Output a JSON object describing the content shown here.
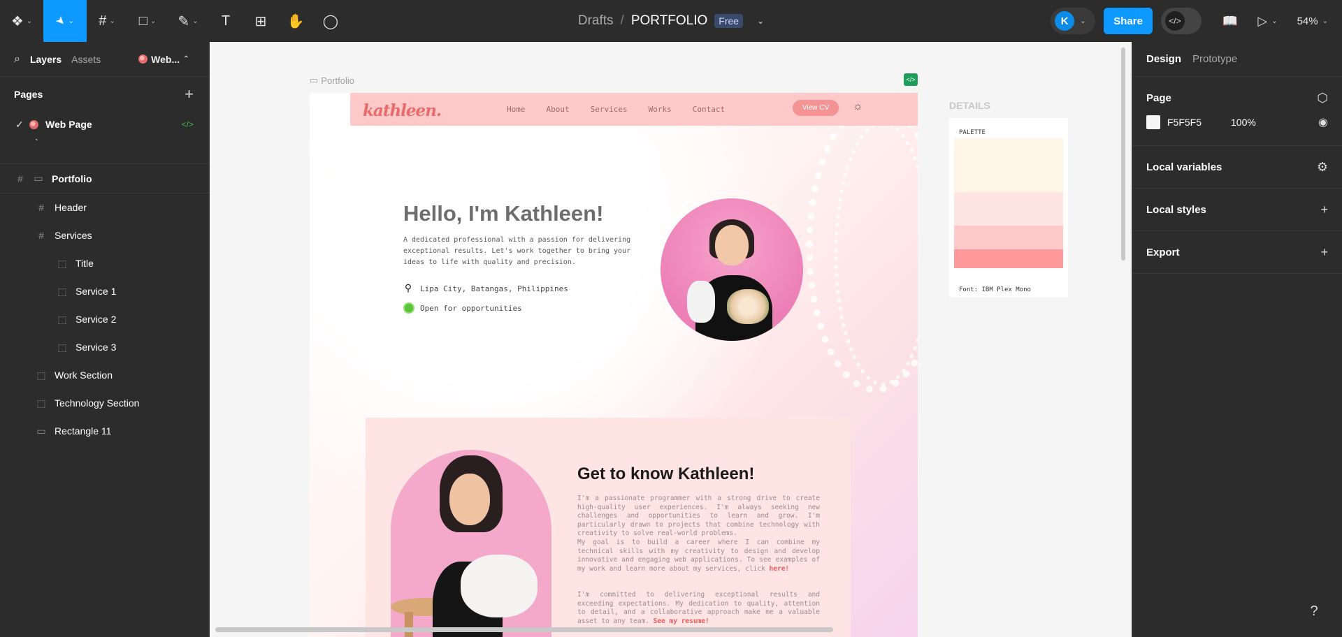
{
  "toolbar": {
    "tools": [
      {
        "icon": "figma-menu-icon",
        "glyph": "❖"
      },
      {
        "icon": "move-cursor-icon",
        "glyph": "➤"
      },
      {
        "icon": "frame-icon",
        "glyph": "#"
      },
      {
        "icon": "rectangle-icon",
        "glyph": "□"
      },
      {
        "icon": "pen-icon",
        "glyph": "✎"
      },
      {
        "icon": "text-icon",
        "glyph": "T"
      },
      {
        "icon": "resources-icon",
        "glyph": "⊞"
      },
      {
        "icon": "hand-icon",
        "glyph": "✋"
      },
      {
        "icon": "comment-icon",
        "glyph": "◯"
      }
    ],
    "breadcrumb_drafts": "Drafts",
    "breadcrumb_sep": "/",
    "file_title": "PORTFOLIO",
    "plan_badge": "Free",
    "avatar_initial": "K",
    "share_label": "Share",
    "zoom": "54%",
    "accent": "#0d99ff"
  },
  "left": {
    "tab_layers": "Layers",
    "tab_assets": "Assets",
    "page_switch": "Web...",
    "pages_label": "Pages",
    "page_name": "Web Page",
    "stray_mark": "`",
    "root_layer": "Portfolio",
    "layers": [
      {
        "name": "Header",
        "icon": "#",
        "indent": 1
      },
      {
        "name": "Services",
        "icon": "#",
        "indent": 1
      },
      {
        "name": "Title",
        "icon": "⬚",
        "indent": 2
      },
      {
        "name": "Service 1",
        "icon": "⬚",
        "indent": 2
      },
      {
        "name": "Service 2",
        "icon": "⬚",
        "indent": 2
      },
      {
        "name": "Service 3",
        "icon": "⬚",
        "indent": 2
      },
      {
        "name": "Work Section",
        "icon": "⬚",
        "indent": 1
      },
      {
        "name": "Technology Section",
        "icon": "⬚",
        "indent": 1
      },
      {
        "name": "Rectangle 11",
        "icon": "▭",
        "indent": 1
      }
    ]
  },
  "canvas": {
    "frame_label": "Portfolio",
    "site": {
      "logo": "kathleen.",
      "nav": [
        "Home",
        "About",
        "Services",
        "Works",
        "Contact"
      ],
      "cv_button": "View CV",
      "hero_title": "Hello, I'm Kathleen!",
      "hero_desc": "A dedicated professional with a passion for delivering exceptional results. Let's work together to bring your ideas to life with quality and precision.",
      "location": "Lipa City, Batangas, Philippines",
      "status": "Open for opportunities",
      "about_title": "Get to know Kathleen!",
      "about_p1": "I'm a passionate programmer with a strong drive to create high-quality user experiences. I'm always seeking new challenges and opportunities to learn and grow. I'm particularly drawn to projects that combine technology with creativity to solve real-world problems.",
      "about_p2": "My goal is to build a career where I can combine my technical skills with my creativity to design and develop innovative and engaging web applications. To see examples of my work and learn more about my services, click ",
      "about_p2_link": "here!",
      "about_p3": "I'm committed to delivering exceptional results and exceeding expectations. My dedication to quality, attention to detail, and a collaborative approach make me a valuable asset to any team. ",
      "about_p3_link": "See my resume!"
    },
    "details": {
      "label": "DETAILS",
      "palette_label": "PALETTE",
      "palette": [
        "#fff5e6",
        "#ffe4e4",
        "#ffc9c9",
        "#ff9a9a"
      ],
      "font_label": "Font: IBM Plex Mono"
    }
  },
  "right": {
    "tab_design": "Design",
    "tab_prototype": "Prototype",
    "page_label": "Page",
    "page_fill_hex": "F5F5F5",
    "page_fill_opacity": "100%",
    "local_variables": "Local variables",
    "local_styles": "Local styles",
    "export": "Export"
  },
  "help": "?"
}
